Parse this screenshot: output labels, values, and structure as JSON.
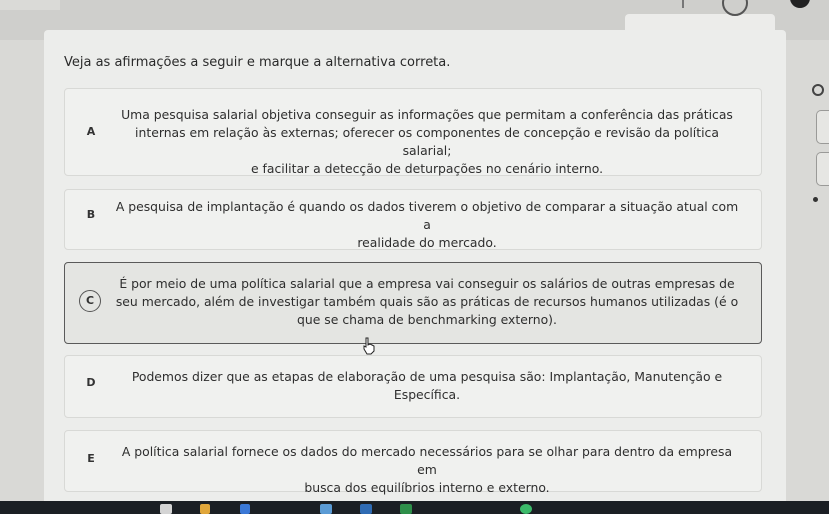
{
  "question": {
    "text": "Veja as afirmações a seguir e marque a alternativa correta."
  },
  "options": [
    {
      "letter": "A",
      "line1": "Uma pesquisa salarial objetiva conseguir as informações que permitam a conferência das práticas",
      "line2": "internas em relação às externas; oferecer os componentes de concepção e revisão da política salarial;",
      "line3": "e facilitar a detecção de deturpações no cenário interno.",
      "selected": false
    },
    {
      "letter": "B",
      "line1": "A pesquisa de implantação é quando os dados tiverem o objetivo de comparar a situação atual com a",
      "line2": "realidade do mercado.",
      "selected": false
    },
    {
      "letter": "C",
      "line1": "É por meio de uma política salarial que a empresa vai conseguir os salários de outras empresas de",
      "line2": "seu mercado, além de investigar também quais são as práticas de recursos humanos utilizadas (é o",
      "line3": "que se chama de benchmarking externo).",
      "selected": true
    },
    {
      "letter": "D",
      "line1": "Podemos dizer que as etapas de elaboração de uma pesquisa são: Implantação, Manutenção e",
      "line2": "Específica.",
      "selected": false
    },
    {
      "letter": "E",
      "line1": "A política salarial fornece os dados do mercado necessários para se olhar para dentro da empresa em",
      "line2": "busca dos equilíbrios interno e externo.",
      "selected": false
    }
  ],
  "icons": {
    "zoom": "magnifier-icon",
    "cursor": "hand-pointer-icon"
  },
  "colors": {
    "panel_bg": "#ecedeb",
    "option_bg": "#f0f1ef",
    "selected_border": "#5a5a5a",
    "taskbar_bg": "#1b1f24"
  }
}
